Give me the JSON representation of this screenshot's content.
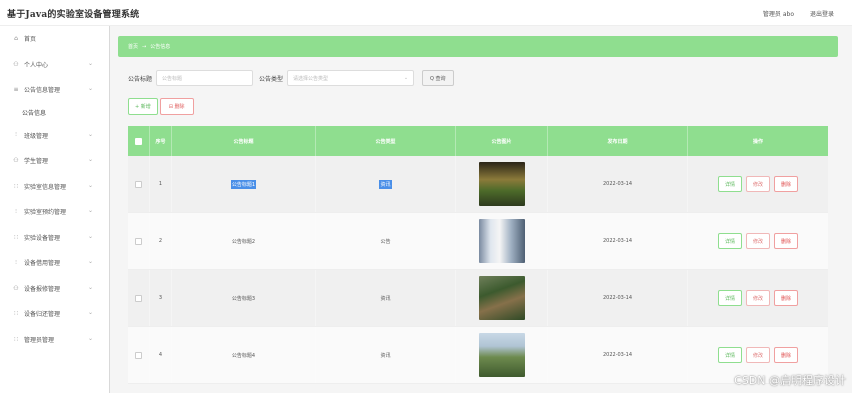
{
  "app": {
    "title": "基于Java的实验室设备管理系统"
  },
  "topbar": {
    "user": "管理员 abo",
    "logout": "退出登录"
  },
  "sidebar": {
    "items": [
      {
        "icon": "⌂",
        "label": "首页",
        "chevron": false
      },
      {
        "icon": "⚇",
        "label": "个人中心",
        "chevron": true
      },
      {
        "icon": "≡",
        "label": "公告信息管理",
        "chevron": true
      },
      {
        "icon": "",
        "label": "公告信息",
        "chevron": false,
        "sub": true
      },
      {
        "icon": "⫶",
        "label": "班级管理",
        "chevron": true
      },
      {
        "icon": "⚇",
        "label": "学生管理",
        "chevron": true
      },
      {
        "icon": "∷",
        "label": "实验室信息管理",
        "chevron": true
      },
      {
        "icon": "⫶",
        "label": "实验室预约管理",
        "chevron": true
      },
      {
        "icon": "∷",
        "label": "实验设备管理",
        "chevron": true
      },
      {
        "icon": "⫶",
        "label": "设备借用管理",
        "chevron": true
      },
      {
        "icon": "⚇",
        "label": "设备报修管理",
        "chevron": true
      },
      {
        "icon": "∷",
        "label": "设备归还管理",
        "chevron": true
      },
      {
        "icon": "∷",
        "label": "管理员管理",
        "chevron": true
      }
    ]
  },
  "breadcrumb": {
    "home": "首页",
    "separator": "→",
    "current": "公告信息"
  },
  "search": {
    "title_label": "公告标题",
    "title_placeholder": "公告标题",
    "type_label": "公告类型",
    "type_placeholder": "请选择公告类型",
    "button": "Q 查询"
  },
  "actions": {
    "add": "+ 新增",
    "delete": "⊟ 删除"
  },
  "table": {
    "headers": [
      "序号",
      "公告标题",
      "公告类型",
      "公告图片",
      "发布日期",
      "操作"
    ],
    "rows": [
      {
        "index": "1",
        "title": "公告标题1",
        "type": "资讯",
        "date": "2022-03-14",
        "highlight": true
      },
      {
        "index": "2",
        "title": "公告标题2",
        "type": "公告",
        "date": "2022-03-14",
        "highlight": false
      },
      {
        "index": "3",
        "title": "公告标题3",
        "type": "资讯",
        "date": "2022-03-14",
        "highlight": false
      },
      {
        "index": "4",
        "title": "公告标题4",
        "type": "资讯",
        "date": "2022-03-14",
        "highlight": false
      }
    ],
    "op_labels": {
      "detail": "详情",
      "edit": "修改",
      "remove": "删除"
    }
  },
  "watermark": "CSDN @启明程序设计",
  "colors": {
    "accent": "#8fde8f",
    "danger": "#e05050"
  }
}
